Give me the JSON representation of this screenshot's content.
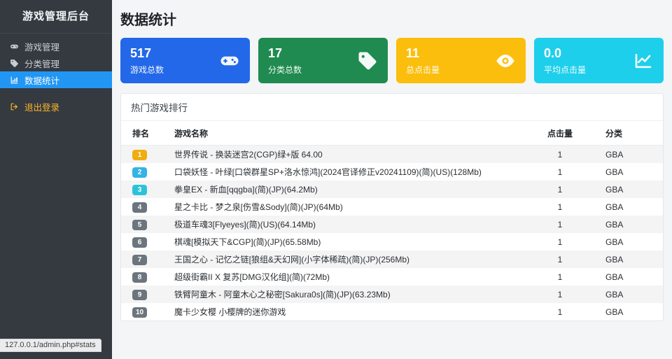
{
  "app": {
    "title": "游戏管理后台",
    "url_status": "127.0.0.1/admin.php#stats"
  },
  "page": {
    "title": "数据统计"
  },
  "sidebar": {
    "items": [
      {
        "label": "游戏管理",
        "icon": "gamepad-icon",
        "active": false,
        "danger": false
      },
      {
        "label": "分类管理",
        "icon": "tag-icon",
        "active": false,
        "danger": false
      },
      {
        "label": "数据统计",
        "icon": "bar-chart-icon",
        "active": true,
        "danger": false
      },
      {
        "label": "退出登录",
        "icon": "logout-icon",
        "active": false,
        "danger": true
      }
    ]
  },
  "stats_cards": [
    {
      "value": "517",
      "label": "游戏总数",
      "color": "#2368e9",
      "icon": "gamepad-icon"
    },
    {
      "value": "17",
      "label": "分类总数",
      "color": "#1f8b50",
      "icon": "tag-icon"
    },
    {
      "value": "11",
      "label": "总点击量",
      "color": "#fcbe0c",
      "icon": "eye-icon"
    },
    {
      "value": "0.0",
      "label": "平均点击量",
      "color": "#1ecfec",
      "icon": "line-chart-icon"
    }
  ],
  "ranking": {
    "panel_title": "热门游戏排行",
    "columns": [
      "排名",
      "游戏名称",
      "点击量",
      "分类"
    ],
    "rows": [
      {
        "rank": "1",
        "badge_color": "#f0ad12",
        "name": "世界传说 - 换装迷宫2(CGP)绿+版 64.00",
        "clicks": "1",
        "category": "GBA"
      },
      {
        "rank": "2",
        "badge_color": "#34b3e4",
        "name": "口袋妖怪 - 叶绿[口袋群星SP+洛水惊鸿](2024官译修正v20241109)(简)(US)(128Mb)",
        "clicks": "1",
        "category": "GBA"
      },
      {
        "rank": "3",
        "badge_color": "#2cc3d8",
        "name": "拳皇EX - 新血[qqgba](简)(JP)(64.2Mb)",
        "clicks": "1",
        "category": "GBA"
      },
      {
        "rank": "4",
        "badge_color": "#6c757d",
        "name": "星之卡比 - 梦之泉[伤雪&Sody](简)(JP)(64Mb)",
        "clicks": "1",
        "category": "GBA"
      },
      {
        "rank": "5",
        "badge_color": "#6c757d",
        "name": "极道车魂3[Flyeyes](简)(US)(64.14Mb)",
        "clicks": "1",
        "category": "GBA"
      },
      {
        "rank": "6",
        "badge_color": "#6c757d",
        "name": "棋魂[模拟天下&CGP](简)(JP)(65.58Mb)",
        "clicks": "1",
        "category": "GBA"
      },
      {
        "rank": "7",
        "badge_color": "#6c757d",
        "name": "王国之心 - 记忆之链[狼组&天幻网](小字体稀疏)(简)(JP)(256Mb)",
        "clicks": "1",
        "category": "GBA"
      },
      {
        "rank": "8",
        "badge_color": "#6c757d",
        "name": "超级街霸II X 复苏[DMG汉化组](简)(72Mb)",
        "clicks": "1",
        "category": "GBA"
      },
      {
        "rank": "9",
        "badge_color": "#6c757d",
        "name": "铁臂阿童木 - 阿童木心之秘密[Sakura0s](简)(JP)(63.23Mb)",
        "clicks": "1",
        "category": "GBA"
      },
      {
        "rank": "10",
        "badge_color": "#6c757d",
        "name": "魔卡少女樱 小樱牌的迷你游戏",
        "clicks": "1",
        "category": "GBA"
      }
    ]
  }
}
